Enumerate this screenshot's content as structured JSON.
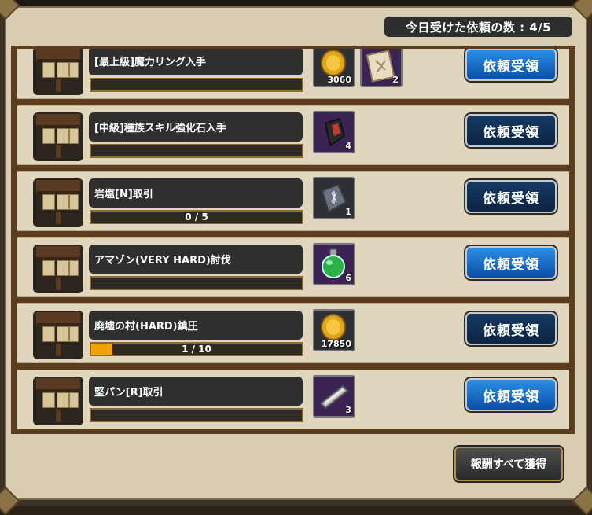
{
  "header": {
    "daily_count_label": "今日受けた依頼の数 : 4/5"
  },
  "quests": [
    {
      "title": "[最上級]魔力リング入手",
      "progress_text": "",
      "progress_fraction": 0,
      "rewards": [
        {
          "icon": "gold-coin-icon",
          "qty": "3060",
          "bg": "dark"
        },
        {
          "icon": "scroll-icon",
          "qty": "2",
          "bg": "purple"
        }
      ],
      "button": "依頼受領",
      "button_style": "bright"
    },
    {
      "title": "[中級]種族スキル強化石入手",
      "progress_text": "",
      "progress_fraction": 0,
      "rewards": [
        {
          "icon": "skill-stone-icon",
          "qty": "4",
          "bg": "purple"
        }
      ],
      "button": "依頼受領",
      "button_style": "dim"
    },
    {
      "title": "岩塩[N]取引",
      "progress_text": "0 / 5",
      "progress_fraction": 0,
      "rewards": [
        {
          "icon": "rock-salt-icon",
          "qty": "1",
          "bg": "dark"
        }
      ],
      "button": "依頼受領",
      "button_style": "dim"
    },
    {
      "title": "アマゾン(VERY HARD)討伐",
      "progress_text": "",
      "progress_fraction": 0,
      "rewards": [
        {
          "icon": "potion-icon",
          "qty": "6",
          "bg": "purple"
        }
      ],
      "button": "依頼受領",
      "button_style": "bright"
    },
    {
      "title": "廃墟の村(HARD)鎮圧",
      "progress_text": "1 / 10",
      "progress_fraction": 0.1,
      "rewards": [
        {
          "icon": "gold-coin-icon",
          "qty": "17850",
          "bg": "dark"
        }
      ],
      "button": "依頼受領",
      "button_style": "dim"
    },
    {
      "title": "堅パン[R]取引",
      "progress_text": "",
      "progress_fraction": 0,
      "rewards": [
        {
          "icon": "hard-bread-icon",
          "qty": "3",
          "bg": "purple"
        }
      ],
      "button": "依頼受領",
      "button_style": "bright"
    }
  ],
  "footer": {
    "claim_all_label": "報酬すべて獲得"
  }
}
